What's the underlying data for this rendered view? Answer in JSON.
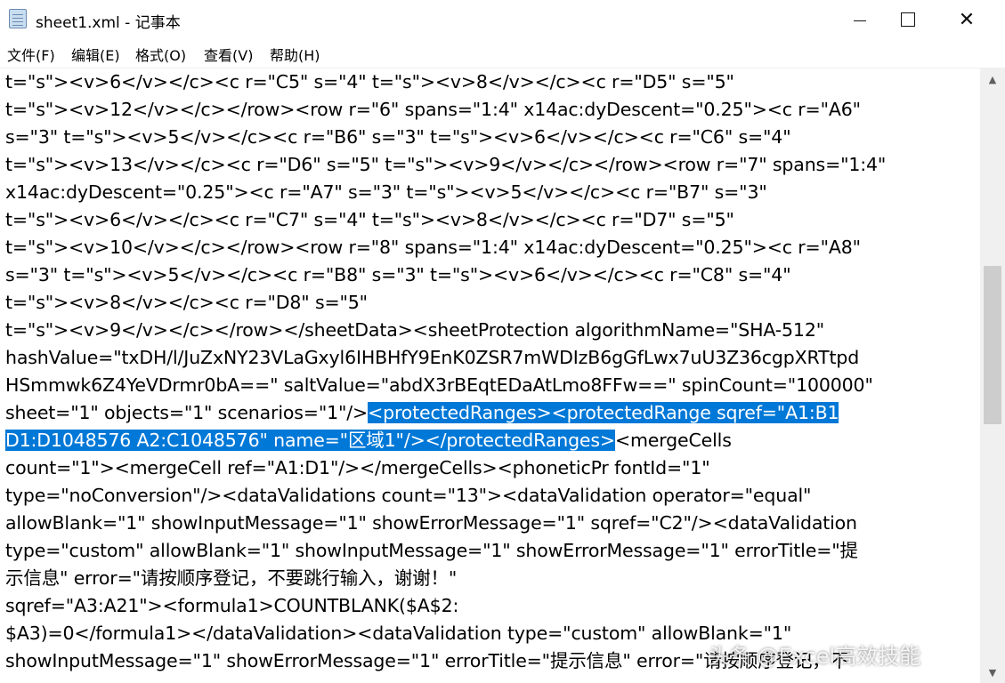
{
  "window": {
    "title": "sheet1.xml - 记事本",
    "minimize_glyph": "",
    "maximize_glyph": "",
    "close_glyph": "✕"
  },
  "menu": [
    "文件(F)",
    "编辑(E)",
    "格式(O)",
    "查看(V)",
    "帮助(H)"
  ],
  "editor": {
    "lines": [
      {
        "pre": "t=\"s\"><v>6</v></c><c r=\"C5\" s=\"4\" t=\"s\"><v>8</v></c><c r=\"D5\" s=\"5\"",
        "sel": "",
        "post": ""
      },
      {
        "pre": "t=\"s\"><v>12</v></c></row><row r=\"6\" spans=\"1:4\" x14ac:dyDescent=\"0.25\"><c r=\"A6\"",
        "sel": "",
        "post": ""
      },
      {
        "pre": "s=\"3\" t=\"s\"><v>5</v></c><c r=\"B6\" s=\"3\" t=\"s\"><v>6</v></c><c r=\"C6\" s=\"4\"",
        "sel": "",
        "post": ""
      },
      {
        "pre": "t=\"s\"><v>13</v></c><c r=\"D6\" s=\"5\" t=\"s\"><v>9</v></c></row><row r=\"7\" spans=\"1:4\"",
        "sel": "",
        "post": ""
      },
      {
        "pre": "x14ac:dyDescent=\"0.25\"><c r=\"A7\" s=\"3\" t=\"s\"><v>5</v></c><c r=\"B7\" s=\"3\"",
        "sel": "",
        "post": ""
      },
      {
        "pre": "t=\"s\"><v>6</v></c><c r=\"C7\" s=\"4\" t=\"s\"><v>8</v></c><c r=\"D7\" s=\"5\"",
        "sel": "",
        "post": ""
      },
      {
        "pre": "t=\"s\"><v>10</v></c></row><row r=\"8\" spans=\"1:4\" x14ac:dyDescent=\"0.25\"><c r=\"A8\"",
        "sel": "",
        "post": ""
      },
      {
        "pre": "s=\"3\" t=\"s\"><v>5</v></c><c r=\"B8\" s=\"3\" t=\"s\"><v>6</v></c><c r=\"C8\" s=\"4\"",
        "sel": "",
        "post": ""
      },
      {
        "pre": "t=\"s\"><v>8</v></c><c r=\"D8\" s=\"5\"",
        "sel": "",
        "post": ""
      },
      {
        "pre": "t=\"s\"><v>9</v></c></row></sheetData><sheetProtection algorithmName=\"SHA-512\"",
        "sel": "",
        "post": ""
      },
      {
        "pre": "hashValue=\"txDH/l/JuZxNY23VLaGxyl6IHBHfY9EnK0ZSR7mWDIzB6gGfLwx7uU3Z36cgpXRTtpd",
        "sel": "",
        "post": ""
      },
      {
        "pre": "HSmmwk6Z4YeVDrmr0bA==\" saltValue=\"abdX3rBEqtEDaAtLmo8FFw==\" spinCount=\"100000\"",
        "sel": "",
        "post": ""
      },
      {
        "pre": "sheet=\"1\" objects=\"1\" scenarios=\"1\"/>",
        "sel": "<protectedRanges><protectedRange sqref=\"A1:B1",
        "post": ""
      },
      {
        "pre": "",
        "sel": "D1:D1048576 A2:C1048576\" name=\"区域1\"/></protectedRanges>",
        "post": "<mergeCells"
      },
      {
        "pre": "count=\"1\"><mergeCell ref=\"A1:D1\"/></mergeCells><phoneticPr fontId=\"1\"",
        "sel": "",
        "post": ""
      },
      {
        "pre": "type=\"noConversion\"/><dataValidations count=\"13\"><dataValidation operator=\"equal\"",
        "sel": "",
        "post": ""
      },
      {
        "pre": "allowBlank=\"1\" showInputMessage=\"1\" showErrorMessage=\"1\" sqref=\"C2\"/><dataValidation",
        "sel": "",
        "post": ""
      },
      {
        "pre": "type=\"custom\" allowBlank=\"1\" showInputMessage=\"1\" showErrorMessage=\"1\" errorTitle=\"提",
        "sel": "",
        "post": ""
      },
      {
        "pre": "示信息\" error=\"请按顺序登记，不要跳行输入，谢谢！\"",
        "sel": "",
        "post": ""
      },
      {
        "pre": "sqref=\"A3:A21\"><formula1>COUNTBLANK($A$2:",
        "sel": "",
        "post": ""
      },
      {
        "pre": "$A3)=0</formula1></dataValidation><dataValidation type=\"custom\" allowBlank=\"1\"",
        "sel": "",
        "post": ""
      },
      {
        "pre": "showInputMessage=\"1\" showErrorMessage=\"1\" errorTitle=\"提示信息\" error=\"请按顺序登记，不",
        "sel": "",
        "post": ""
      }
    ]
  },
  "watermark": "头条 @Excel高效技能"
}
